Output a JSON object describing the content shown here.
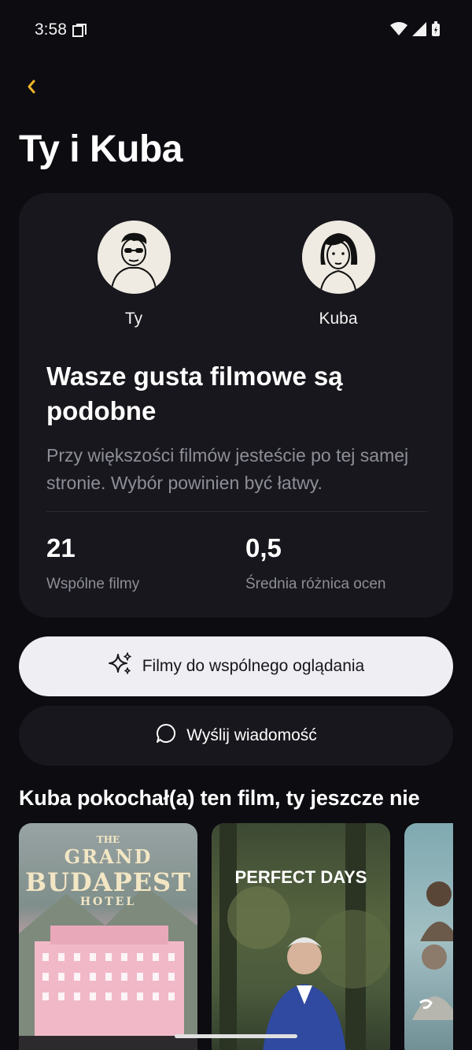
{
  "status_bar": {
    "time": "3:58"
  },
  "header": {
    "title": "Ty i Kuba"
  },
  "users": {
    "you": "Ty",
    "friend": "Kuba"
  },
  "match": {
    "title": "Wasze gusta filmowe są podobne",
    "description": "Przy większości filmów jesteście po tej samej stronie. Wybór powinien być łatwy."
  },
  "stats": [
    {
      "value": "21",
      "label": "Wspólne filmy"
    },
    {
      "value": "0,5",
      "label": "Średnia różnica ocen"
    }
  ],
  "actions": {
    "primary_label": "Filmy do wspólnego oglądania",
    "secondary_label": "Wyślij wiadomość"
  },
  "section": {
    "title": "Kuba pokochał(a) ten film, ty jeszcze nie",
    "posters": [
      {
        "title_line1": "THE",
        "title_line2": "GRAND",
        "title_line3": "BUDAPEST",
        "title_line4": "HOTEL"
      },
      {
        "title": "PERFECT DAYS"
      },
      {
        "title": ""
      }
    ]
  },
  "colors": {
    "accent": "#f0b429",
    "background": "#0c0c11",
    "card": "#17171d"
  }
}
